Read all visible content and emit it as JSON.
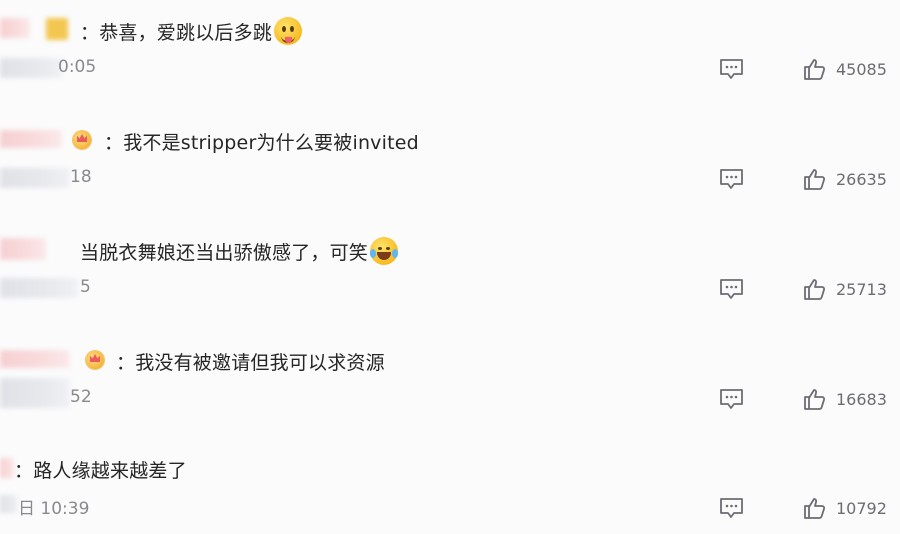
{
  "comments": [
    {
      "text": "：恭喜，爱跳以后多跳",
      "time_fragment": "0:05",
      "emoji": "tongue-face",
      "has_badge": false,
      "likes": "45085"
    },
    {
      "text": "：我不是stripper为什么要被invited",
      "time_fragment": "18",
      "emoji": "",
      "has_badge": true,
      "likes": "26635"
    },
    {
      "text": "当脱衣舞娘还当出骄傲感了，可笑",
      "time_fragment": "5",
      "emoji": "tears-of-joy",
      "has_badge": false,
      "likes": "25713"
    },
    {
      "text": "：我没有被邀请但我可以求资源",
      "time_fragment": "52",
      "emoji": "",
      "has_badge": true,
      "likes": "16683"
    },
    {
      "text": "：路人缘越来越差了",
      "time_fragment": "日 10:39",
      "emoji": "",
      "has_badge": false,
      "likes": "10792"
    }
  ],
  "icons": {
    "reply": "comment-bubble-icon",
    "like": "thumbs-up-icon"
  },
  "colors": {
    "background": "#fbfbfc",
    "text": "#262626",
    "meta": "#888a8f",
    "icon": "#6b6d72"
  }
}
